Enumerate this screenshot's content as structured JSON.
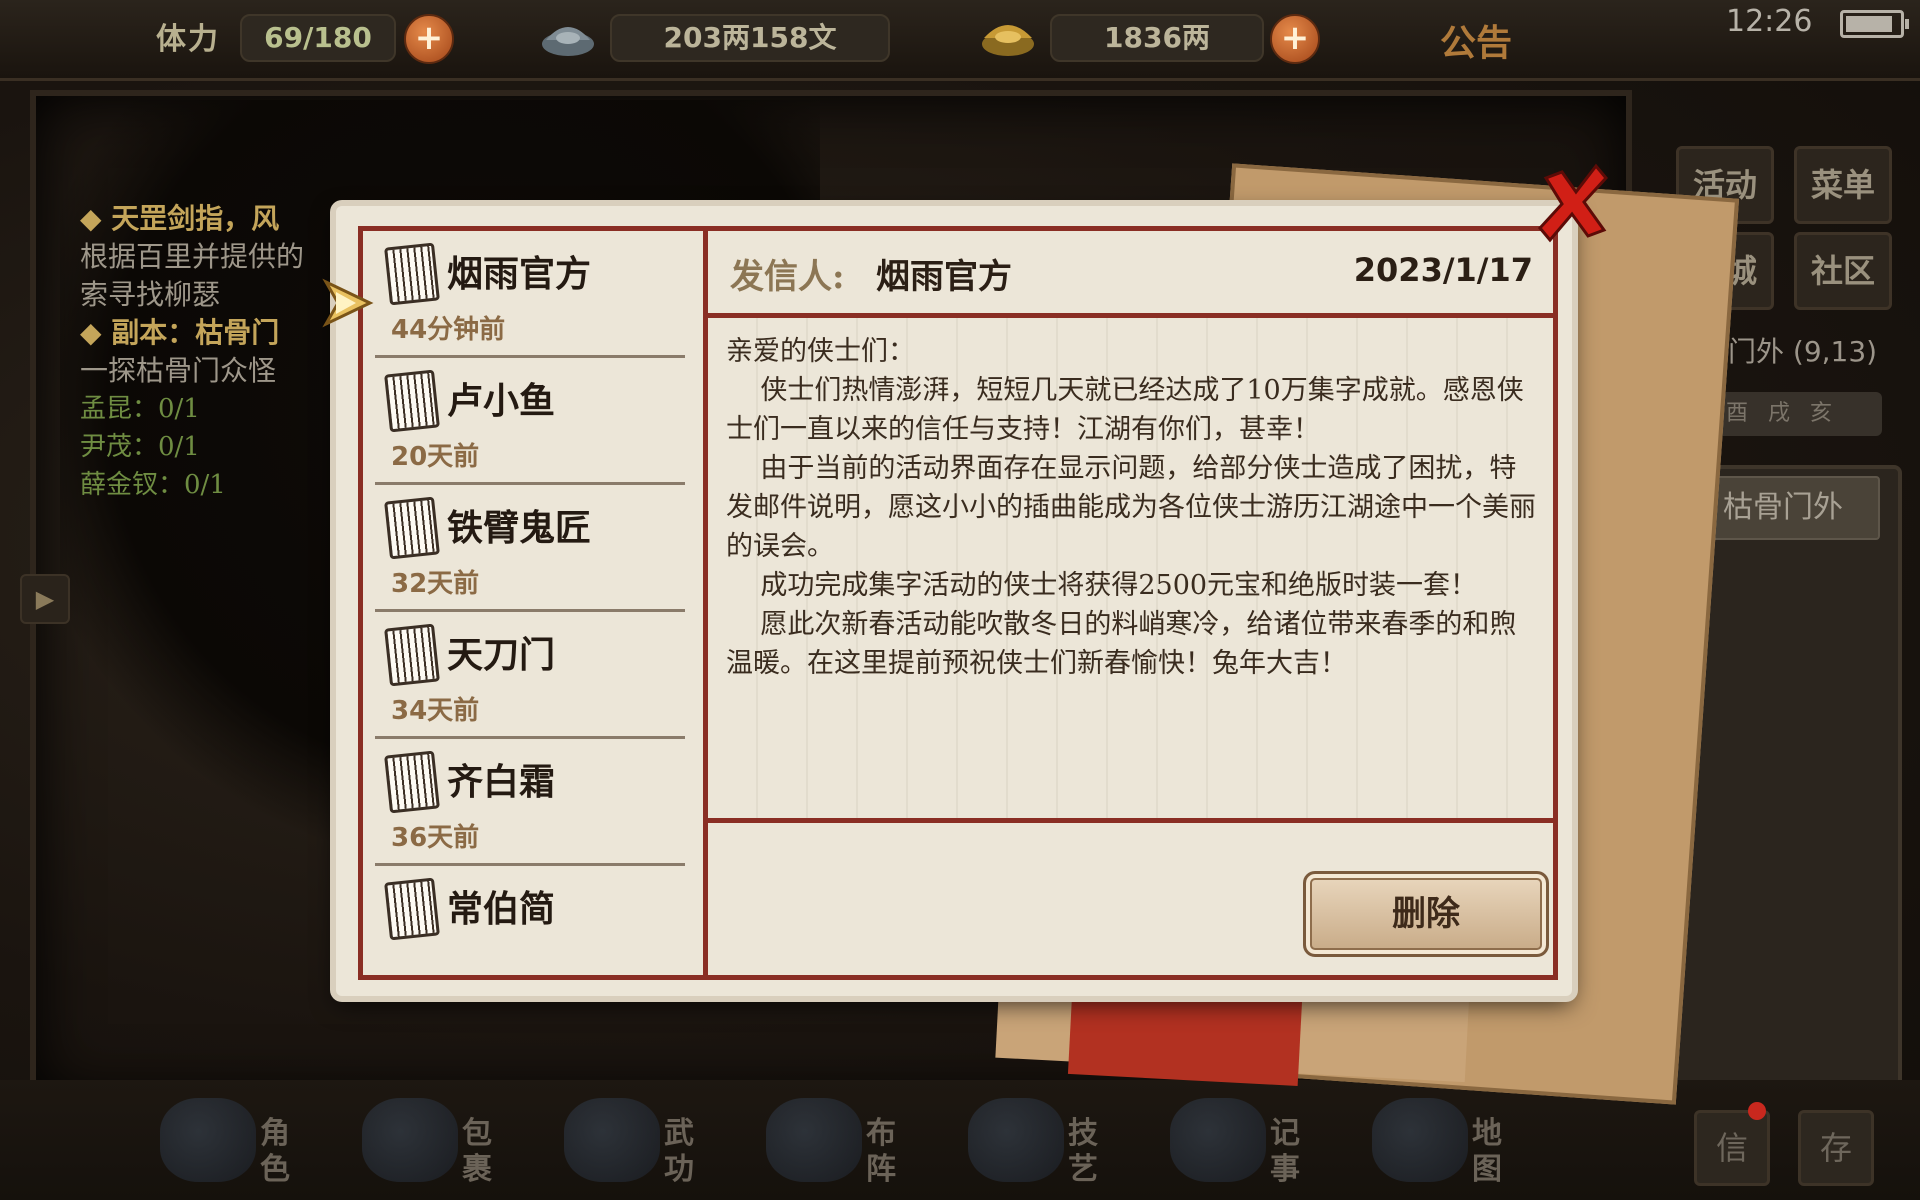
{
  "topbar": {
    "stamina_label": "体力",
    "stamina_value": "69/180",
    "silver_value": "203两158文",
    "gold_value": "1836两",
    "notice_label": "公告",
    "clock": "12:26"
  },
  "quest": {
    "lines": [
      {
        "kind": "title",
        "text": "◆ 天罡剑指，风"
      },
      {
        "kind": "text",
        "text": "根据百里并提供的"
      },
      {
        "kind": "text",
        "text": "索寻找柳瑟"
      },
      {
        "kind": "title",
        "text": "◆ 副本：枯骨门"
      },
      {
        "kind": "text",
        "text": "一探枯骨门众怪"
      },
      {
        "kind": "count",
        "text": "孟昆：0/1"
      },
      {
        "kind": "count",
        "text": "尹茂：0/1"
      },
      {
        "kind": "count",
        "text": "薛金钗：0/1"
      }
    ]
  },
  "right_panel": {
    "activity": "活动",
    "menu": "菜单",
    "shop": "商城",
    "community": "社区",
    "location": "骨门外 (9,13)",
    "compass": "酉戌亥",
    "map_button": "枯骨门外"
  },
  "bottom_nav": [
    {
      "label": "角色",
      "icon": "character-icon"
    },
    {
      "label": "包裹",
      "icon": "bag-icon"
    },
    {
      "label": "武功",
      "icon": "martial-arts-icon"
    },
    {
      "label": "布阵",
      "icon": "formation-icon"
    },
    {
      "label": "技艺",
      "icon": "skills-icon"
    },
    {
      "label": "记事",
      "icon": "journal-icon"
    },
    {
      "label": "地图",
      "icon": "map-icon"
    }
  ],
  "bottom_small": {
    "mail": "信",
    "save": "存"
  },
  "mail": {
    "items": [
      {
        "sender": "烟雨官方",
        "time": "44分钟前"
      },
      {
        "sender": "卢小鱼",
        "time": "20天前"
      },
      {
        "sender": "铁臂鬼匠",
        "time": "32天前"
      },
      {
        "sender": "天刀门",
        "time": "34天前"
      },
      {
        "sender": "齐白霜",
        "time": "36天前"
      },
      {
        "sender": "常伯简",
        "time": ""
      }
    ],
    "selected": {
      "sender_label": "发信人:",
      "sender_name": "烟雨官方",
      "date": "2023/1/17",
      "body": "亲爱的侠士们：\n    侠士们热情澎湃，短短几天就已经达成了10万集字成就。感恩侠士们一直以来的信任与支持！江湖有你们，甚幸！\n    由于当前的活动界面存在显示问题，给部分侠士造成了困扰，特发邮件说明，愿这小小的插曲能成为各位侠士游历江湖途中一个美丽的误会。\n    成功完成集字活动的侠士将获得2500元宝和绝版时装一套！\n    愿此次新春活动能吹散冬日的料峭寒冷，给诸位带来春季的和煦温暖。在这里提前预祝侠士们新春愉快！兔年大吉！"
    },
    "delete_label": "删除"
  },
  "colors": {
    "dialog_border": "#8a2e24",
    "paper": "#ece6d8",
    "plus_button": "#c85a24",
    "close_x": "#d11f16"
  }
}
